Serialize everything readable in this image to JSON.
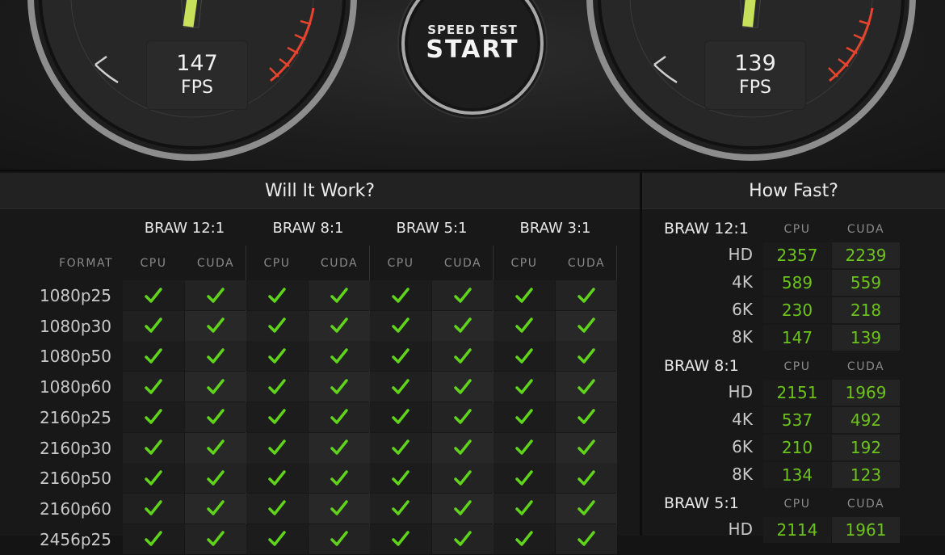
{
  "gauges": [
    {
      "value": "147",
      "unit": "FPS"
    },
    {
      "value": "139",
      "unit": "FPS"
    }
  ],
  "start_button": {
    "line1": "SPEED TEST",
    "line2": "START"
  },
  "will_it_work": {
    "title": "Will It Work?",
    "format_header": "FORMAT",
    "groups": [
      "BRAW 12:1",
      "BRAW 8:1",
      "BRAW 5:1",
      "BRAW 3:1"
    ],
    "sub_columns": [
      "CPU",
      "CUDA"
    ],
    "rows": [
      "1080p25",
      "1080p30",
      "1080p50",
      "1080p60",
      "2160p25",
      "2160p30",
      "2160p50",
      "2160p60",
      "2456p25"
    ],
    "check_color": "#5fd41a"
  },
  "how_fast": {
    "title": "How Fast?",
    "sub_columns": [
      "CPU",
      "CUDA"
    ],
    "groups": [
      {
        "name": "BRAW 12:1",
        "rows": [
          {
            "res": "HD",
            "cpu": "2357",
            "cuda": "2239"
          },
          {
            "res": "4K",
            "cpu": "589",
            "cuda": "559"
          },
          {
            "res": "6K",
            "cpu": "230",
            "cuda": "218"
          },
          {
            "res": "8K",
            "cpu": "147",
            "cuda": "139"
          }
        ]
      },
      {
        "name": "BRAW 8:1",
        "rows": [
          {
            "res": "HD",
            "cpu": "2151",
            "cuda": "1969"
          },
          {
            "res": "4K",
            "cpu": "537",
            "cuda": "492"
          },
          {
            "res": "6K",
            "cpu": "210",
            "cuda": "192"
          },
          {
            "res": "8K",
            "cpu": "134",
            "cuda": "123"
          }
        ]
      },
      {
        "name": "BRAW 5:1",
        "rows": [
          {
            "res": "HD",
            "cpu": "2114",
            "cuda": "1961"
          }
        ]
      }
    ],
    "value_color": "#6cc31a"
  }
}
